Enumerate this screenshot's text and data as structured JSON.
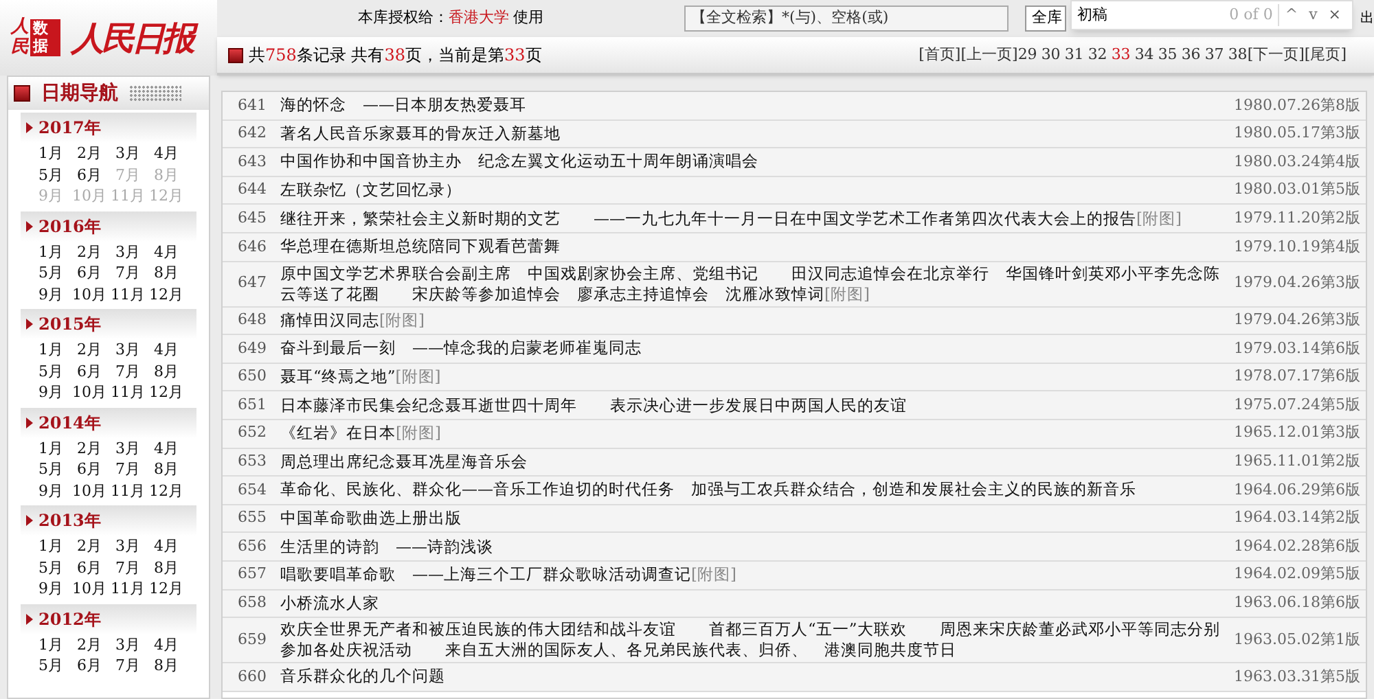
{
  "logo": {
    "mark": "人民",
    "badge": "数据",
    "masthead": "人民日报"
  },
  "license": {
    "prefix": "本库授权给：",
    "licensee": "香港大学",
    "suffix": "使用"
  },
  "search": {
    "placeholder": "【全文检索】*(与)、空格(或)",
    "button": "全库",
    "logout": "出"
  },
  "find_bar": {
    "value": "初稿",
    "count": "0 of 0",
    "prev": "^",
    "next": "v",
    "close": "×"
  },
  "summary": [
    {
      "text": "共",
      "highlight": false
    },
    {
      "text": "758",
      "highlight": true
    },
    {
      "text": "条记录 共有",
      "highlight": false
    },
    {
      "text": "38",
      "highlight": true
    },
    {
      "text": "页，当前是第",
      "highlight": false
    },
    {
      "text": "33",
      "highlight": true
    },
    {
      "text": "页",
      "highlight": false
    }
  ],
  "pagination": {
    "first": "[首页]",
    "prev": "[上一页]",
    "pages": [
      {
        "label": "29",
        "selected": false
      },
      {
        "label": "30",
        "selected": false
      },
      {
        "label": "31",
        "selected": false
      },
      {
        "label": "32",
        "selected": false
      },
      {
        "label": "33",
        "selected": true
      },
      {
        "label": "34",
        "selected": false
      },
      {
        "label": "35",
        "selected": false
      },
      {
        "label": "36",
        "selected": false
      },
      {
        "label": "37",
        "selected": false
      },
      {
        "label": "38",
        "selected": false
      }
    ],
    "next": "[下一页]",
    "last": "[尾页]"
  },
  "sidebar": {
    "title": "日期导航",
    "years": [
      {
        "label": "2017年",
        "months": [
          {
            "label": "1月",
            "disabled": false
          },
          {
            "label": "2月",
            "disabled": false
          },
          {
            "label": "3月",
            "disabled": false
          },
          {
            "label": "4月",
            "disabled": false
          },
          {
            "label": "5月",
            "disabled": false
          },
          {
            "label": "6月",
            "disabled": false
          },
          {
            "label": "7月",
            "disabled": true
          },
          {
            "label": "8月",
            "disabled": true
          },
          {
            "label": "9月",
            "disabled": true
          },
          {
            "label": "10月",
            "disabled": true
          },
          {
            "label": "11月",
            "disabled": true
          },
          {
            "label": "12月",
            "disabled": true
          }
        ]
      },
      {
        "label": "2016年",
        "months": [
          {
            "label": "1月",
            "disabled": false
          },
          {
            "label": "2月",
            "disabled": false
          },
          {
            "label": "3月",
            "disabled": false
          },
          {
            "label": "4月",
            "disabled": false
          },
          {
            "label": "5月",
            "disabled": false
          },
          {
            "label": "6月",
            "disabled": false
          },
          {
            "label": "7月",
            "disabled": false
          },
          {
            "label": "8月",
            "disabled": false
          },
          {
            "label": "9月",
            "disabled": false
          },
          {
            "label": "10月",
            "disabled": false
          },
          {
            "label": "11月",
            "disabled": false
          },
          {
            "label": "12月",
            "disabled": false
          }
        ]
      },
      {
        "label": "2015年",
        "months": [
          {
            "label": "1月",
            "disabled": false
          },
          {
            "label": "2月",
            "disabled": false
          },
          {
            "label": "3月",
            "disabled": false
          },
          {
            "label": "4月",
            "disabled": false
          },
          {
            "label": "5月",
            "disabled": false
          },
          {
            "label": "6月",
            "disabled": false
          },
          {
            "label": "7月",
            "disabled": false
          },
          {
            "label": "8月",
            "disabled": false
          },
          {
            "label": "9月",
            "disabled": false
          },
          {
            "label": "10月",
            "disabled": false
          },
          {
            "label": "11月",
            "disabled": false
          },
          {
            "label": "12月",
            "disabled": false
          }
        ]
      },
      {
        "label": "2014年",
        "months": [
          {
            "label": "1月",
            "disabled": false
          },
          {
            "label": "2月",
            "disabled": false
          },
          {
            "label": "3月",
            "disabled": false
          },
          {
            "label": "4月",
            "disabled": false
          },
          {
            "label": "5月",
            "disabled": false
          },
          {
            "label": "6月",
            "disabled": false
          },
          {
            "label": "7月",
            "disabled": false
          },
          {
            "label": "8月",
            "disabled": false
          },
          {
            "label": "9月",
            "disabled": false
          },
          {
            "label": "10月",
            "disabled": false
          },
          {
            "label": "11月",
            "disabled": false
          },
          {
            "label": "12月",
            "disabled": false
          }
        ]
      },
      {
        "label": "2013年",
        "months": [
          {
            "label": "1月",
            "disabled": false
          },
          {
            "label": "2月",
            "disabled": false
          },
          {
            "label": "3月",
            "disabled": false
          },
          {
            "label": "4月",
            "disabled": false
          },
          {
            "label": "5月",
            "disabled": false
          },
          {
            "label": "6月",
            "disabled": false
          },
          {
            "label": "7月",
            "disabled": false
          },
          {
            "label": "8月",
            "disabled": false
          },
          {
            "label": "9月",
            "disabled": false
          },
          {
            "label": "10月",
            "disabled": false
          },
          {
            "label": "11月",
            "disabled": false
          },
          {
            "label": "12月",
            "disabled": false
          }
        ]
      },
      {
        "label": "2012年",
        "months": [
          {
            "label": "1月",
            "disabled": false
          },
          {
            "label": "2月",
            "disabled": false
          },
          {
            "label": "3月",
            "disabled": false
          },
          {
            "label": "4月",
            "disabled": false
          },
          {
            "label": "5月",
            "disabled": false
          },
          {
            "label": "6月",
            "disabled": false
          },
          {
            "label": "7月",
            "disabled": false
          },
          {
            "label": "8月",
            "disabled": false
          }
        ]
      }
    ]
  },
  "results": [
    {
      "number": "641",
      "title": "海的怀念　——日本朋友热爱聂耳",
      "date": "1980.07.26第8版"
    },
    {
      "number": "642",
      "title": "著名人民音乐家聂耳的骨灰迁入新墓地",
      "date": "1980.05.17第3版"
    },
    {
      "number": "643",
      "title": "中国作协和中国音协主办　纪念左翼文化运动五十周年朗诵演唱会",
      "date": "1980.03.24第4版"
    },
    {
      "number": "644",
      "title": "左联杂忆（文艺回忆录）",
      "date": "1980.03.01第5版"
    },
    {
      "number": "645",
      "title": "继往开来，繁荣社会主义新时期的文艺　　——一九七九年十一月一日在中国文学艺术工作者第四次代表大会上的报告",
      "attachment": "[附图]",
      "date": "1979.11.20第2版"
    },
    {
      "number": "646",
      "title": "华总理在德斯坦总统陪同下观看芭蕾舞",
      "date": "1979.10.19第4版"
    },
    {
      "number": "647",
      "title": "原中国文学艺术界联合会副主席　中国戏剧家协会主席、党组书记　　田汉同志追悼会在北京举行　华国锋叶剑英邓小平李先念陈云等送了花圈　　宋庆龄等参加追悼会　廖承志主持追悼会　沈雁冰致悼词",
      "attachment": "[附图]",
      "date": "1979.04.26第3版"
    },
    {
      "number": "648",
      "title": "痛悼田汉同志",
      "attachment": "[附图]",
      "date": "1979.04.26第3版"
    },
    {
      "number": "649",
      "title": "奋斗到最后一刻　——悼念我的启蒙老师崔嵬同志",
      "date": "1979.03.14第6版"
    },
    {
      "number": "650",
      "title": "聂耳“终焉之地”",
      "attachment": "[附图]",
      "date": "1978.07.17第6版"
    },
    {
      "number": "651",
      "title": "日本藤泽市民集会纪念聂耳逝世四十周年　　表示决心进一步发展日中两国人民的友谊",
      "date": "1975.07.24第5版"
    },
    {
      "number": "652",
      "title": "《红岩》在日本",
      "attachment": "[附图]",
      "date": "1965.12.01第3版"
    },
    {
      "number": "653",
      "title": "周总理出席纪念聂耳冼星海音乐会",
      "date": "1965.11.01第2版"
    },
    {
      "number": "654",
      "title": "革命化、民族化、群众化——音乐工作迫切的时代任务　加强与工农兵群众结合，创造和发展社会主义的民族的新音乐",
      "date": "1964.06.29第6版"
    },
    {
      "number": "655",
      "title": "中国革命歌曲选上册出版",
      "date": "1964.03.14第2版"
    },
    {
      "number": "656",
      "title": "生活里的诗韵　——诗韵浅谈",
      "date": "1964.02.28第6版"
    },
    {
      "number": "657",
      "title": "唱歌要唱革命歌　——上海三个工厂群众歌咏活动调查记",
      "attachment": "[附图]",
      "date": "1964.02.09第5版"
    },
    {
      "number": "658",
      "title": "小桥流水人家",
      "date": "1963.06.18第6版"
    },
    {
      "number": "659",
      "title": "欢庆全世界无产者和被压迫民族的伟大团结和战斗友谊　　首都三百万人“五一”大联欢　　周恩来宋庆龄董必武邓小平等同志分别参加各处庆祝活动　　来自五大洲的国际友人、各兄弟民族代表、归侨、　港澳同胞共度节日",
      "date": "1963.05.02第1版"
    },
    {
      "number": "660",
      "title": "音乐群众化的几个问题",
      "date": "1963.03.31第5版"
    }
  ]
}
